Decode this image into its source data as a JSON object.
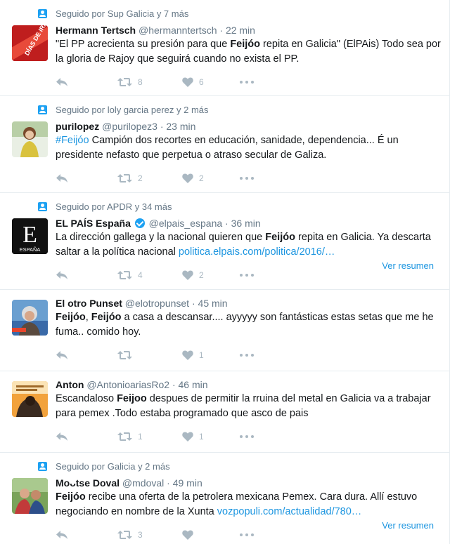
{
  "tweets": [
    {
      "context": "Seguido por Sup Galicia y 7 más",
      "name": "Hermann Tertsch",
      "handle": "@hermanntertsch",
      "time": "22 min",
      "text_a": "\"El PP acrecienta su presión para que ",
      "text_b": "Feijóo",
      "text_c": " repita en Galicia\" (ElPAis) Todo sea por la gloria de Rajoy que seguirá cuando no exista el PP.",
      "retweets": "8",
      "likes": "6",
      "avatar_text": "DÍAS DE IRA"
    },
    {
      "context": "Seguido por loly garcia perez y 2 más",
      "name": "purilopez",
      "handle": "@purilopez3",
      "time": "23 min",
      "hashtag": "#Feijóo",
      "text_c": "  Campión dos recortes en educación, sanidade, dependencia... É un presidente nefasto que perpetua o atraso secular de Galiza.",
      "retweets": "2",
      "likes": "2"
    },
    {
      "context": "Seguido por APDR y 34 más",
      "name": "EL PAÍS España",
      "handle": "@elpais_espana",
      "time": "36 min",
      "text_a": "La dirección gallega y la nacional quieren que ",
      "text_b": "Feijóo",
      "text_c": " repita en Galicia. Ya descarta saltar a la política nacional ",
      "link": "politica.elpais.com/politica/2016/…",
      "retweets": "4",
      "likes": "2",
      "summary": "Ver resumen",
      "avatar_letter": "E",
      "avatar_sub": "ESPAÑA"
    },
    {
      "name": "El otro Punset",
      "handle": "@elotropunset",
      "time": "45 min",
      "text_a": "",
      "text_b": "Feijóo",
      "text_mid": ", ",
      "text_b2": "Feijóo",
      "text_c": " a casa a descansar.... ayyyyy son fantásticas estas setas que me he fuma.. comido hoy.",
      "retweets": "",
      "likes": "1"
    },
    {
      "name": "Anton",
      "handle": "@AntonioariasRo2",
      "time": "46 min",
      "text_a": "Escandaloso ",
      "text_b": "Feijoo",
      "text_c": " despues de permitir la rruina del metal en Galicia va a trabajar para pemex .Todo estaba programado que asco de pais",
      "retweets": "1",
      "likes": "1"
    },
    {
      "context": "Seguido por Galicia y 2 más",
      "name": "Moᴗtse Doval",
      "handle": "@mdoval",
      "time": "49 min",
      "text_a": "",
      "text_b": "Feijóo",
      "text_c": " recibe una oferta de la petrolera mexicana Pemex. Cara dura. Allí estuvo negociando en nombre de la Xunta ",
      "link": "vozpopuli.com/actualidad/780…",
      "retweets": "3",
      "likes": "",
      "summary": "Ver resumen"
    }
  ],
  "colors": {
    "accent": "#1da1f2",
    "link": "#1b95e0",
    "muted": "#657786",
    "icon": "#aab8c2"
  },
  "icons": [
    "follow-context-icon",
    "reply-icon",
    "retweet-icon",
    "like-icon",
    "more-icon",
    "verified-icon"
  ]
}
